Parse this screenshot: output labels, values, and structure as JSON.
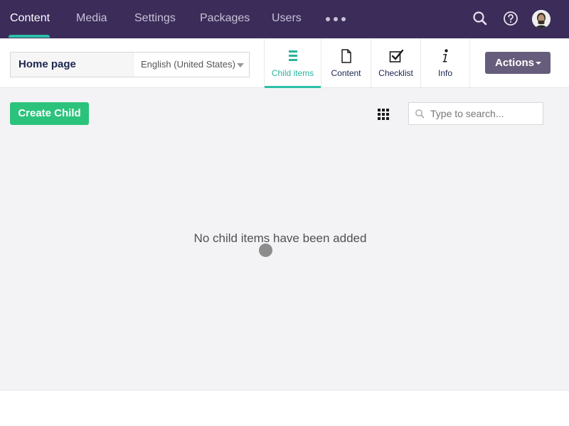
{
  "topnav": {
    "items": [
      {
        "label": "Content",
        "active": true
      },
      {
        "label": "Media",
        "active": false
      },
      {
        "label": "Settings",
        "active": false
      },
      {
        "label": "Packages",
        "active": false
      },
      {
        "label": "Users",
        "active": false
      }
    ],
    "more_icon": "more-dots-icon",
    "search_icon": "search-icon",
    "help_icon": "help-icon",
    "avatar_icon": "user-avatar"
  },
  "header": {
    "node_name": "Home page",
    "language": "English (United States)",
    "apps": [
      {
        "label": "Child items",
        "icon": "list-icon",
        "active": true
      },
      {
        "label": "Content",
        "icon": "document-icon",
        "active": false
      },
      {
        "label": "Checklist",
        "icon": "checklist-icon",
        "active": false
      },
      {
        "label": "Info",
        "icon": "info-icon",
        "active": false
      }
    ],
    "actions_label": "Actions"
  },
  "main": {
    "create_child_label": "Create Child",
    "grid_icon": "grid-view-icon",
    "search_placeholder": "Type to search...",
    "empty_message": "No child items have been added"
  },
  "colors": {
    "nav_bg": "#3b2c59",
    "accent": "#2bc0a8",
    "create_button": "#2bc37c",
    "actions_button": "#665c7b",
    "main_bg": "#f3f3f5"
  }
}
